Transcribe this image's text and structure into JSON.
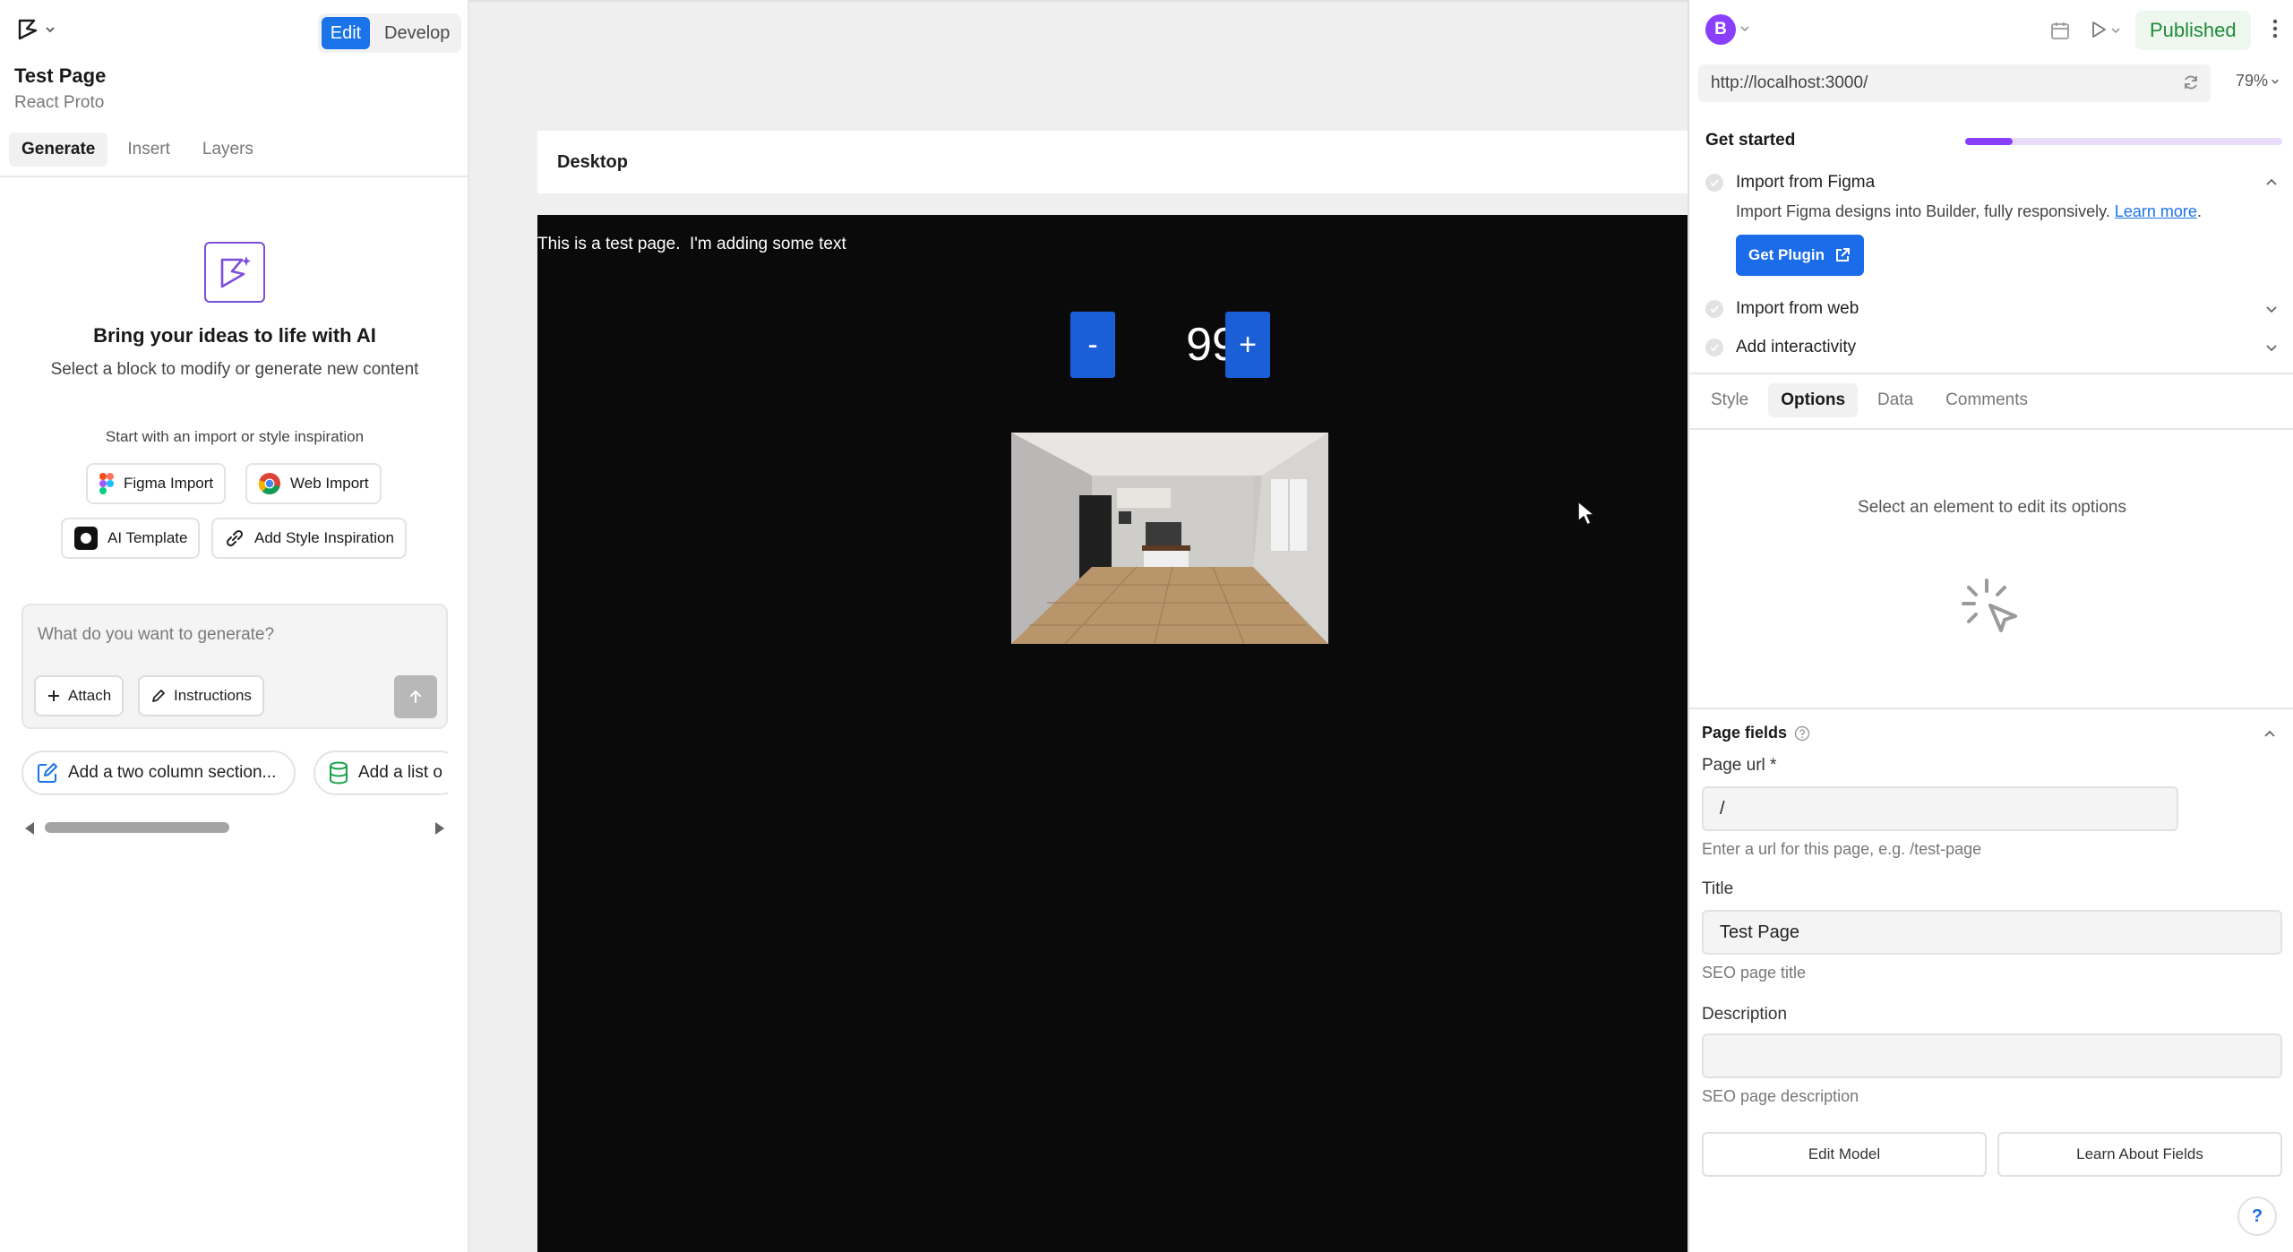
{
  "header": {
    "mode_edit": "Edit",
    "mode_develop": "Develop",
    "page_title": "Test Page",
    "page_subtitle": "React Proto"
  },
  "left_tabs": [
    "Generate",
    "Insert",
    "Layers"
  ],
  "ai": {
    "heading": "Bring your ideas to life with AI",
    "subheading": "Select a block to modify or generate new content",
    "import_heading": "Start with an import or style inspiration",
    "chips": {
      "figma": "Figma Import",
      "web": "Web Import",
      "template": "AI Template",
      "style": "Add Style Inspiration"
    },
    "prompt_placeholder": "What do you want to generate?",
    "attach_label": "Attach",
    "instructions_label": "Instructions",
    "suggestions": [
      "Add a two column section...",
      "Add a list o"
    ]
  },
  "canvas": {
    "device_label": "Desktop",
    "text": "This is a test page.  I'm adding some text",
    "minus_label": "-",
    "plus_label": "+",
    "count": "99"
  },
  "right": {
    "avatar_letter": "B",
    "publish_label": "Published",
    "url": "http://localhost:3000/",
    "zoom": "79%",
    "get_started": {
      "label": "Get started",
      "progress": 0.15,
      "items": [
        "Import from Figma",
        "Import from web",
        "Add interactivity"
      ],
      "figma_desc": "Import Figma designs into Builder, fully responsively.",
      "learn_more": "Learn more",
      "learn_more_suffix": ".",
      "plugin_label": "Get Plugin"
    },
    "tabs": [
      "Style",
      "Options",
      "Data",
      "Comments"
    ],
    "empty_message": "Select an element to edit its options",
    "page_fields": {
      "title": "Page fields",
      "url_label": "Page url *",
      "url_value": "/",
      "url_hint": "Enter a url for this page, e.g. /test-page",
      "title_label": "Title",
      "title_value": "Test Page",
      "title_hint": "SEO page title",
      "desc_label": "Description",
      "desc_value": "",
      "desc_hint": "SEO page description"
    },
    "edit_model_label": "Edit Model",
    "learn_fields_label": "Learn About Fields",
    "help_label": "?"
  },
  "colors": {
    "accent": "#1a73e8",
    "purple": "#8a3ffc",
    "publish_green": "#1f8a3a",
    "canvas_bg": "#0a0a0a"
  }
}
